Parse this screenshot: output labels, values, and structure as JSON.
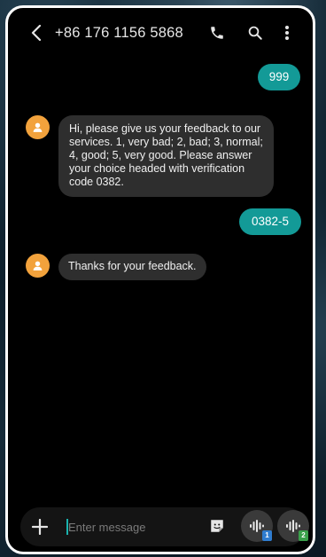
{
  "header": {
    "contact": "+86 176 1156 5868",
    "icons": [
      "back-arrow-icon",
      "phone-icon",
      "search-icon",
      "more-options-icon"
    ]
  },
  "messages": [
    {
      "direction": "outgoing",
      "text": "999"
    },
    {
      "direction": "incoming",
      "text": "Hi, please give us your feedback to our services. 1, very bad; 2, bad; 3, normal; 4, good; 5, very good. Please answer your choice headed with verification code 0382."
    },
    {
      "direction": "outgoing",
      "text": "0382-5"
    },
    {
      "direction": "incoming",
      "text": "Thanks for your feedback."
    }
  ],
  "composer": {
    "placeholder": "Enter message",
    "value": "",
    "sim1_label": "1",
    "sim2_label": "2",
    "sim1_color": "#2f7ccf",
    "sim2_color": "#3aa04a"
  },
  "colors": {
    "outgoing_bubble": "#139a97",
    "incoming_bubble": "#2e2e2e",
    "avatar": "#f2a23c",
    "frame": "#ffffff"
  }
}
